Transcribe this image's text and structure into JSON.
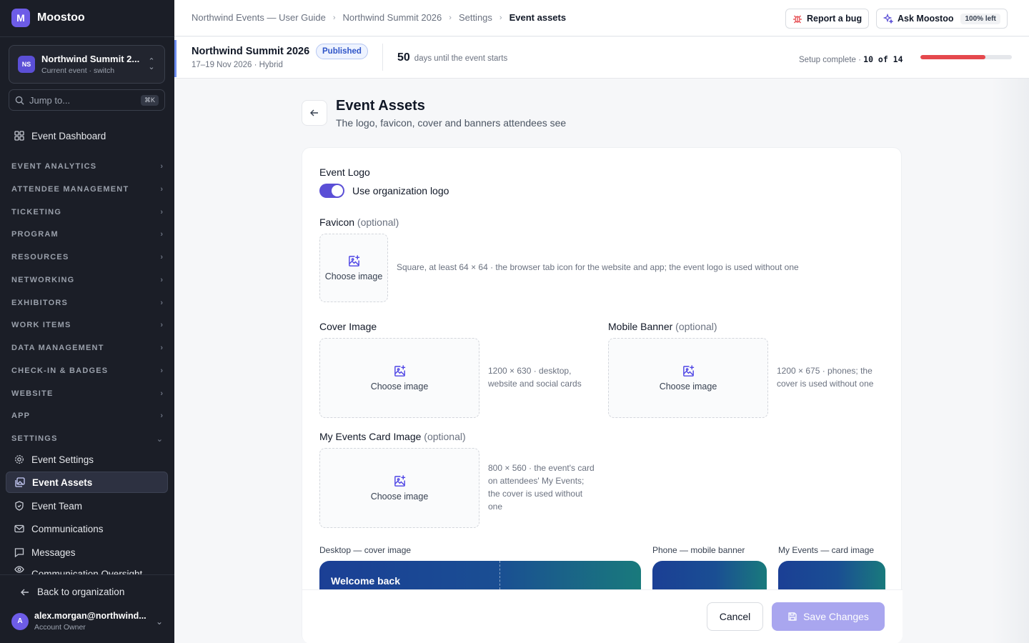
{
  "app": {
    "name": "Moostoo",
    "logo_letter": "M",
    "accent": "#6d5ce7"
  },
  "sidebar": {
    "event_selector": {
      "initials": "NS",
      "name": "Northwind Summit 2...",
      "sub": "Current event · switch"
    },
    "jump": {
      "placeholder": "Jump to...",
      "shortcut": "⌘K"
    },
    "dashboard": "Event Dashboard",
    "sections": [
      "EVENT ANALYTICS",
      "ATTENDEE MANAGEMENT",
      "TICKETING",
      "PROGRAM",
      "RESOURCES",
      "NETWORKING",
      "EXHIBITORS",
      "WORK ITEMS",
      "DATA MANAGEMENT",
      "CHECK-IN & BADGES",
      "WEBSITE",
      "APP",
      "SETTINGS"
    ],
    "settings_items": [
      "Event Settings",
      "Event Assets",
      "Event Team",
      "Communications",
      "Messages",
      "Communication Oversight"
    ],
    "back_label": "Back to organization",
    "user": {
      "initial": "A",
      "email": "alex.morgan@northwind...",
      "role": "Account Owner"
    }
  },
  "topbar": {
    "breadcrumbs": [
      "Northwind Events — User Guide",
      "Northwind Summit 2026",
      "Settings",
      "Event assets"
    ],
    "report_bug": "Report a bug",
    "ask": "Ask Moostoo",
    "ask_quota": "100% left"
  },
  "event_bar": {
    "title": "Northwind Summit 2026",
    "status": "Published",
    "dates": "17–19 Nov 2026 · Hybrid",
    "days": "50",
    "days_label": "days until the event starts",
    "setup_label": "Setup complete ·",
    "setup_value": "10 of 14",
    "setup_fraction": 0.714,
    "progress_color": "#e5484d"
  },
  "page": {
    "title": "Event Assets",
    "subtitle": "The logo, favicon, cover and banners attendees see"
  },
  "form": {
    "logo_label": "Event Logo",
    "logo_toggle_label": "Use organization logo",
    "logo_toggle_on": true,
    "optional": "(optional)",
    "choose_image": "Choose image",
    "favicon": {
      "label": "Favicon",
      "hint": "Square, at least 64 × 64 · the browser tab icon for the website and app; the event logo is used without one"
    },
    "cover": {
      "label": "Cover Image",
      "hint": "1200 × 630 · desktop, website and social cards"
    },
    "mobile_banner": {
      "label": "Mobile Banner",
      "hint": "1200 × 675 · phones; the cover is used without one"
    },
    "card_image": {
      "label": "My Events Card Image",
      "hint": "800 × 560 · the event's card on attendees' My Events; the cover is used without one"
    },
    "previews": {
      "desktop": "Desktop — cover image",
      "phone": "Phone — mobile banner",
      "card": "My Events — card image",
      "welcome": "Welcome back"
    },
    "cancel": "Cancel",
    "save": "Save Changes"
  }
}
